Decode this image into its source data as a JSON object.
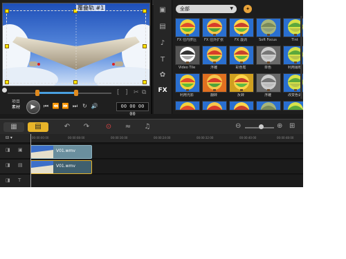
{
  "preview": {
    "overlay_title": "覆叠轨 #1",
    "mode_labels": [
      "项目",
      "素材"
    ],
    "timecode": "00 00 00 00",
    "controls": {
      "play": "▶",
      "home": "⏮",
      "prev": "⏪",
      "next": "⏩",
      "end": "⏭",
      "repeat": "↻",
      "volume": "🔊"
    },
    "trim_markers": [
      "[",
      "]",
      "✂",
      "⧉"
    ]
  },
  "library": {
    "category": "全部",
    "tool_icons": [
      "video-library-icon",
      "photo-library-icon",
      "audio-library-icon",
      "title-icon",
      "graphics-icon",
      "fx-icon"
    ],
    "fx_label": "FX",
    "thumbnails": [
      {
        "label": "FX 往内挤压"
      },
      {
        "label": "FX 往外扩张"
      },
      {
        "label": "FX 漩涡"
      },
      {
        "label": "Soft Focus"
      },
      {
        "label": "Tint"
      },
      {
        "label": "Video Tile"
      },
      {
        "label": "浮雕"
      },
      {
        "label": "彩色笔"
      },
      {
        "label": "单色"
      },
      {
        "label": "利用最暗"
      },
      {
        "label": "利用光影"
      },
      {
        "label": "翻转"
      },
      {
        "label": "反转"
      },
      {
        "label": "浮雕"
      },
      {
        "label": "改变色调"
      },
      {
        "label": ""
      },
      {
        "label": ""
      },
      {
        "label": ""
      },
      {
        "label": ""
      },
      {
        "label": ""
      }
    ]
  },
  "toolbar": {
    "storyboard": "▦",
    "timeline": "▤",
    "undo": "↶",
    "redo": "↷",
    "record": "⊙",
    "audio_mixer": "≈",
    "auto_music": "♫",
    "zoom_out": "⊖",
    "zoom_in": "⊕",
    "fit": "⊞"
  },
  "ruler": {
    "ticks": [
      "00:00:00:00",
      "00:00:08:00",
      "00:00:16:00",
      "00:00:24:00",
      "00:00:32:00",
      "00:00:40:00",
      "00:00:48:00"
    ],
    "zoom_level": 0.55
  },
  "tracks": [
    {
      "name": "video",
      "clip_label": "V01.wmv"
    },
    {
      "name": "overlay",
      "clip_label": "V01.wmv"
    }
  ]
}
